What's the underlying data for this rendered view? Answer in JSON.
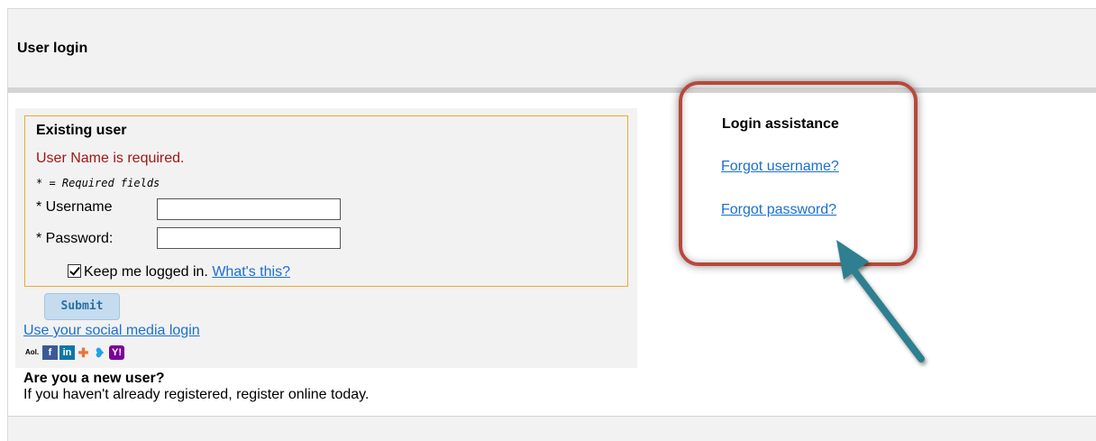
{
  "header": {
    "title": "User login"
  },
  "existing_user": {
    "heading": "Existing user",
    "error": "User Name is required.",
    "required_note": "* = Required fields",
    "username_label": "* Username",
    "username_value": "",
    "password_label": "* Password:",
    "password_value": "",
    "keep_logged_in_label": "Keep me logged in.",
    "keep_logged_in_checked": true,
    "whats_this_link": "What's this?"
  },
  "submit_label": "Submit",
  "social": {
    "link_text": "Use your social media login",
    "icons": [
      "aol-icon",
      "facebook-icon",
      "linkedin-icon",
      "google-icon",
      "twitter-icon",
      "yahoo-icon"
    ],
    "aol_text": "Aol."
  },
  "new_user": {
    "heading": "Are you a new user?",
    "text": "If you haven't already registered, register online today."
  },
  "assistance": {
    "heading": "Login assistance",
    "forgot_username": "Forgot username?",
    "forgot_password": "Forgot password?"
  },
  "colors": {
    "error": "#a31515",
    "link": "#1a6fd1",
    "highlight_border": "#b8483a",
    "arrow": "#2f7f8f",
    "box_border": "#f0a830"
  }
}
